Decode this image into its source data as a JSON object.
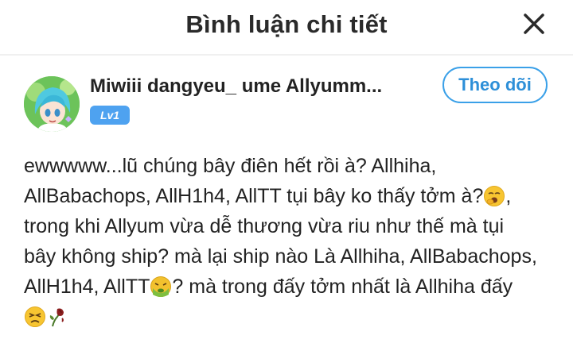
{
  "header": {
    "title": "Bình luận chi tiết",
    "close_icon": "close-icon"
  },
  "user": {
    "name": "Miwiii dangyeu_ ume Allyumm...",
    "level": "Lv1",
    "follow_label": "Theo dõi",
    "accent_color": "#3aa0e8",
    "badge_color": "#4ea2f0"
  },
  "comment": {
    "line1": "ewwwww...lũ chúng bây điên hết rồi à? Allhiha,",
    "line2": "AllBabachops, AllH1h4, AllTT tụi bây ko thấy tởm à?",
    "line2_end": ",",
    "line3": "trong khi Allyum vừa dễ thương vừa riu như thế mà tụi",
    "line4": "bây không ship? mà lại ship nào Là Allhiha, AllBabachops,",
    "line5": "AllH1h4, AllTT",
    "line5_end": "? mà trong đấy tởm nhất là Allhiha đấy",
    "emojis": [
      "yawning-face-emoji",
      "nauseated-face-emoji",
      "persevering-face-emoji",
      "wilted-rose-emoji"
    ]
  }
}
